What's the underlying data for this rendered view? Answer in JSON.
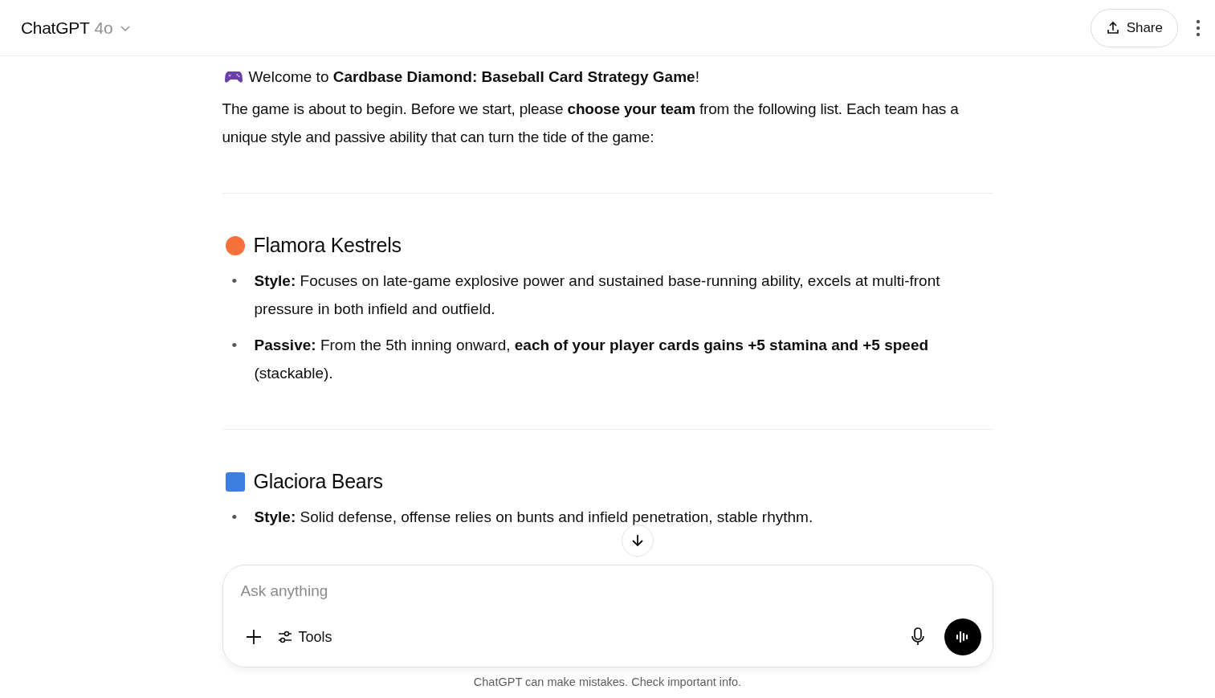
{
  "header": {
    "title": "ChatGPT",
    "model": "4o",
    "share": "Share"
  },
  "message": {
    "welcome": "Welcome to **Cardbase Diamond: Baseball Card Strategy Game**!",
    "intro": "The game is about to begin. Before we start, please **choose your team** from the following list. Each team has a unique style and passive ability that can turn the tide of the game:",
    "teams": [
      {
        "name": "Flamora Kestrels",
        "kind": "circle",
        "color": "#f5703a",
        "bullets": [
          {
            "marker": "•",
            "text": "**Style:** Focuses on late-game explosive power and sustained base-running ability, excels at multi-front pressure in both infield and outfield."
          },
          {
            "marker": "•",
            "text": "**Passive:** From the 5th inning onward, **each of your player cards gains +5 stamina and +5 speed** (stackable)."
          }
        ]
      },
      {
        "name": "Glaciora Bears",
        "kind": "square",
        "color": "#3d7fe0",
        "bullets": [
          {
            "marker": "•",
            "text": "**Style:** Solid defense, offense relies on bunts and infield penetration, stable rhythm."
          }
        ]
      }
    ]
  },
  "composer": {
    "placeholder": "Ask anything",
    "tools": "Tools"
  },
  "disclaimer": "ChatGPT can make mistakes. Check important info."
}
